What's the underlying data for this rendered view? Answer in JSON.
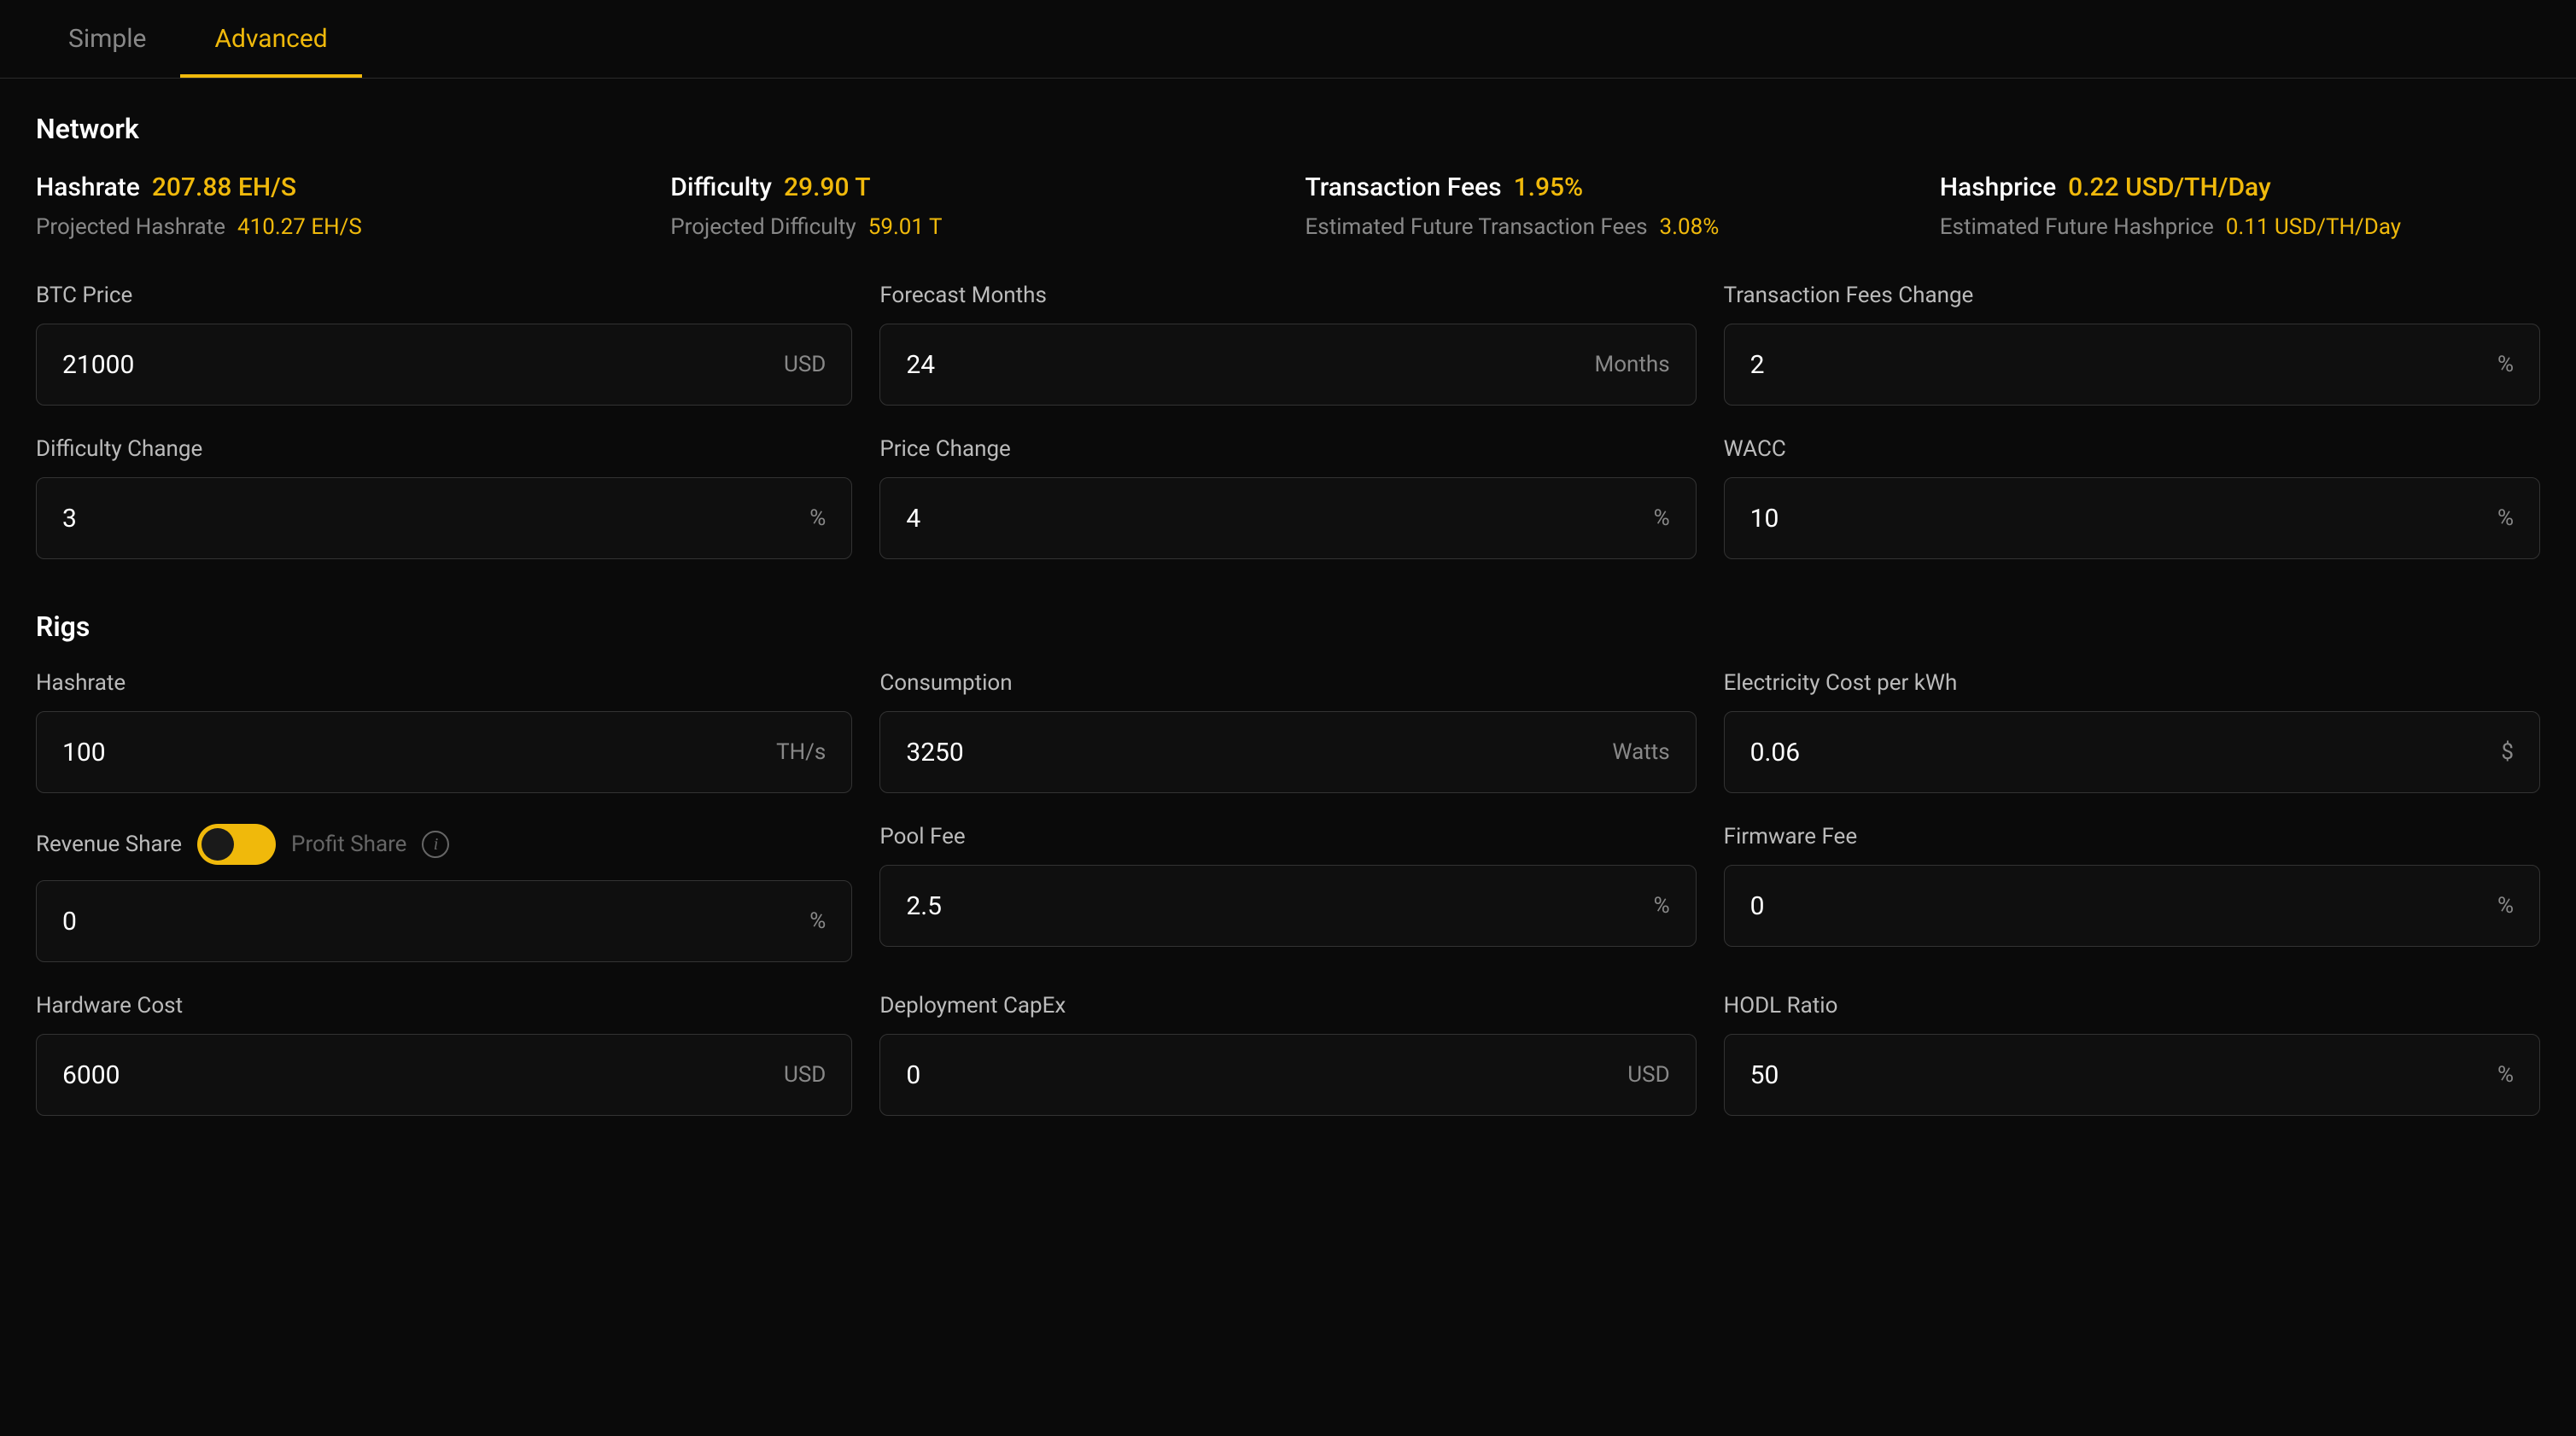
{
  "tabs": {
    "simple": "Simple",
    "advanced": "Advanced"
  },
  "network": {
    "title": "Network",
    "hashrate": {
      "label": "Hashrate",
      "value": "207.88 EH/S",
      "sub_label": "Projected Hashrate",
      "sub_value": "410.27 EH/S"
    },
    "difficulty": {
      "label": "Difficulty",
      "value": "29.90 T",
      "sub_label": "Projected Difficulty",
      "sub_value": "59.01 T"
    },
    "tx_fees": {
      "label": "Transaction Fees",
      "value": "1.95%",
      "sub_label": "Estimated Future Transaction Fees",
      "sub_value": "3.08%"
    },
    "hashprice": {
      "label": "Hashprice",
      "value": "0.22 USD/TH/Day",
      "sub_label": "Estimated Future Hashprice",
      "sub_value": "0.11 USD/TH/Day"
    },
    "inputs": {
      "btc_price": {
        "label": "BTC Price",
        "value": "21000",
        "suffix": "USD"
      },
      "forecast_months": {
        "label": "Forecast Months",
        "value": "24",
        "suffix": "Months"
      },
      "tx_fees_change": {
        "label": "Transaction Fees Change",
        "value": "2",
        "suffix": "%"
      },
      "difficulty_change": {
        "label": "Difficulty Change",
        "value": "3",
        "suffix": "%"
      },
      "price_change": {
        "label": "Price Change",
        "value": "4",
        "suffix": "%"
      },
      "wacc": {
        "label": "WACC",
        "value": "10",
        "suffix": "%"
      }
    }
  },
  "rigs": {
    "title": "Rigs",
    "inputs": {
      "hashrate": {
        "label": "Hashrate",
        "value": "100",
        "suffix": "TH/s"
      },
      "consumption": {
        "label": "Consumption",
        "value": "3250",
        "suffix": "Watts"
      },
      "elec_cost": {
        "label": "Electricity Cost per kWh",
        "value": "0.06",
        "suffix": "$"
      },
      "revenue_share": {
        "label": "Revenue Share",
        "alt_label": "Profit Share",
        "value": "0",
        "suffix": "%"
      },
      "pool_fee": {
        "label": "Pool Fee",
        "value": "2.5",
        "suffix": "%"
      },
      "firmware_fee": {
        "label": "Firmware Fee",
        "value": "0",
        "suffix": "%"
      },
      "hardware_cost": {
        "label": "Hardware Cost",
        "value": "6000",
        "suffix": "USD"
      },
      "deployment_capex": {
        "label": "Deployment CapEx",
        "value": "0",
        "suffix": "USD"
      },
      "hodl_ratio": {
        "label": "HODL Ratio",
        "value": "50",
        "suffix": "%"
      }
    }
  }
}
